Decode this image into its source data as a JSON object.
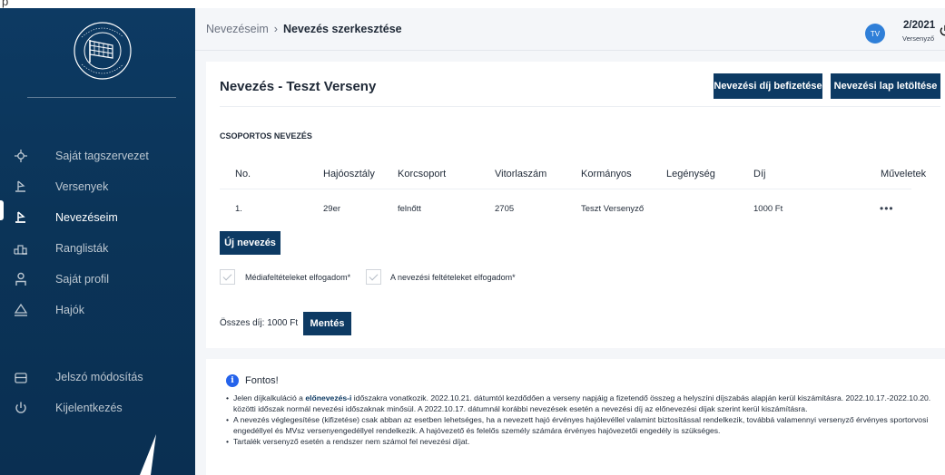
{
  "top_partial": "p",
  "sidebar": {
    "items": [
      {
        "label": "Saját tagszervezet",
        "icon": "crosshair-icon"
      },
      {
        "label": "Versenyek",
        "icon": "sailboat-icon"
      },
      {
        "label": "Nevezéseim",
        "icon": "sailboat-icon",
        "active": true
      },
      {
        "label": "Ranglisták",
        "icon": "podium-icon"
      },
      {
        "label": "Saját profil",
        "icon": "user-icon"
      },
      {
        "label": "Hajók",
        "icon": "triangle-boat-icon"
      }
    ],
    "bottom_items": [
      {
        "label": "Jelszó módosítás",
        "icon": "lock-icon"
      },
      {
        "label": "Kijelentkezés",
        "icon": "power-icon"
      }
    ]
  },
  "header": {
    "breadcrumb_parent": "Nevezéseim",
    "breadcrumb_sep": "›",
    "breadcrumb_current": "Nevezés szerkesztése",
    "avatar_initials": "TV",
    "user_id": "2/2021",
    "user_role": "Versenyző"
  },
  "card": {
    "title": "Nevezés - Teszt Verseny",
    "btn_fee": "Nevezési díj befizetése",
    "btn_download": "Nevezési lap letöltése",
    "section_title": "CSOPORTOS NEVEZÉS",
    "columns": [
      "No.",
      "Hajóosztály",
      "Korcsoport",
      "Vitorlaszám",
      "Kormányos",
      "Legénység",
      "Díj",
      "Műveletek"
    ],
    "rows": [
      {
        "no": "1.",
        "class": "29er",
        "age_group": "felnőtt",
        "sail_number": "2705",
        "helmsman": "Teszt Versenyző",
        "crew": "",
        "fee": "1000 Ft",
        "actions": "•••"
      }
    ],
    "btn_new": "Új nevezés",
    "check_media": "Médiafeltételeket elfogadom*",
    "check_terms": "A nevezési feltételeket elfogadom*",
    "total_label": "Összes díj: 1000 Ft",
    "btn_save": "Mentés"
  },
  "notice": {
    "title": "Fontos!",
    "b1_pre": "Jelen díjkalkuláció a ",
    "b1_hl": "előnevezés-i",
    "b1_post": " időszakra vonatkozik. 2022.10.21. dátumtól kezdődően a verseny napjáig a fizetendő összeg a helyszíni díjszabás alapján kerül kiszámításra. 2022.10.17.-2022.10.20. közötti időszak normál nevezési időszaknak minősül. A 2022.10.17. dátumnál korábbi nevezések esetén a nevezési díj az előnevezési díjak szerint kerül kiszámításra.",
    "b2": "A nevezés véglegesítése (kifizetése) csak abban az esetben lehetséges, ha a nevezett hajó érvényes hajólevéllel valamint biztosítással rendelkezik, továbbá valamennyi versenyző érvényes sportorvosi engedéllyel és MVsz versenyengedéllyel rendelkezik. A hajóvezető és felelős személy számára érvényes hajóvezetői engedély is szükséges.",
    "b3": "Tartalék versenyző esetén a rendszer nem számol fel nevezési díjat."
  },
  "colors": {
    "sidebar": "#0d3a63",
    "primary_button": "#0d3a63",
    "avatar": "#2f7fd8",
    "info": "#2563eb"
  }
}
